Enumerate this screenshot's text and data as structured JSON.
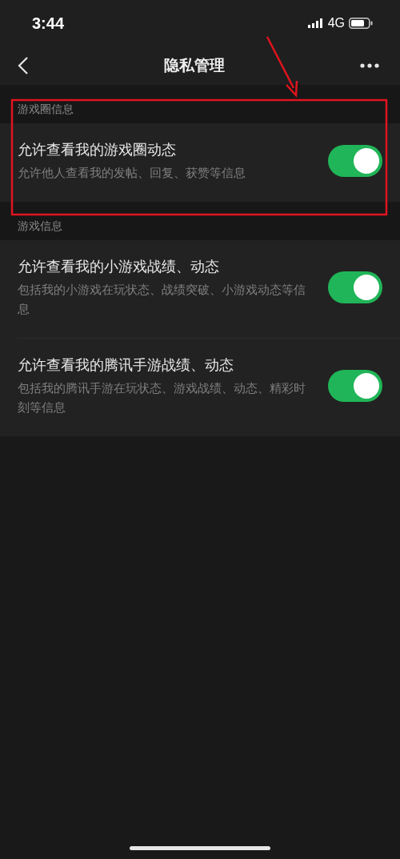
{
  "status_bar": {
    "time": "3:44",
    "network": "4G"
  },
  "nav": {
    "title": "隐私管理"
  },
  "sections": [
    {
      "header": "游戏圈信息",
      "items": [
        {
          "title": "允许查看我的游戏圈动态",
          "description": "允许他人查看我的发帖、回复、获赞等信息",
          "on": true
        }
      ]
    },
    {
      "header": "游戏信息",
      "items": [
        {
          "title": "允许查看我的小游戏战绩、动态",
          "description": "包括我的小游戏在玩状态、战绩突破、小游戏动态等信息",
          "on": true
        },
        {
          "title": "允许查看我的腾讯手游战绩、动态",
          "description": "包括我的腾讯手游在玩状态、游戏战绩、动态、精彩时刻等信息",
          "on": true
        }
      ]
    }
  ]
}
